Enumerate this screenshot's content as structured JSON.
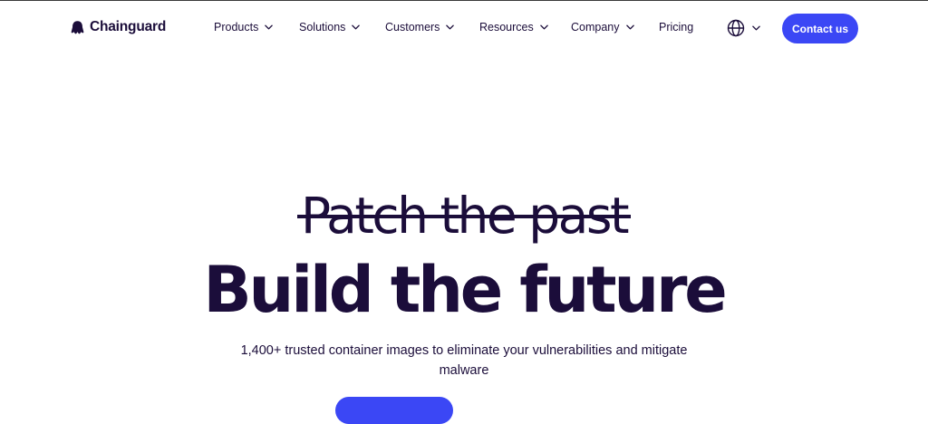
{
  "brand": {
    "name": "Chainguard"
  },
  "nav": {
    "items": [
      {
        "label": "Products",
        "has_dropdown": true
      },
      {
        "label": "Solutions",
        "has_dropdown": true
      },
      {
        "label": "Customers",
        "has_dropdown": true
      },
      {
        "label": "Resources",
        "has_dropdown": true
      },
      {
        "label": "Company",
        "has_dropdown": true
      },
      {
        "label": "Pricing",
        "has_dropdown": false
      }
    ],
    "language_icon": "globe-icon",
    "contact_label": "Contact us"
  },
  "hero": {
    "struck_text": "Patch the past",
    "title": "Build the future",
    "subtitle": "1,400+ trusted container images to eliminate your vulnerabilities and mitigate malware"
  },
  "colors": {
    "primary": "#3b47f5",
    "text": "#1b0d3a",
    "background": "#ffffff"
  }
}
